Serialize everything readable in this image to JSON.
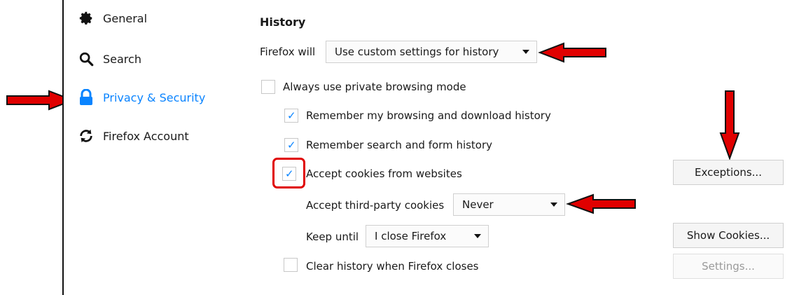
{
  "sidebar": {
    "items": [
      {
        "label": "General",
        "icon": "gear-icon"
      },
      {
        "label": "Search",
        "icon": "magnifier-icon"
      },
      {
        "label": "Privacy & Security",
        "icon": "lock-icon",
        "active": true
      },
      {
        "label": "Firefox Account",
        "icon": "sync-icon"
      }
    ]
  },
  "history": {
    "heading": "History",
    "firefox_will_label": "Firefox will",
    "firefox_will_value": "Use custom settings for history",
    "private_mode": {
      "label": "Always use private browsing mode",
      "checked": false
    },
    "remember_browsing": {
      "label": "Remember my browsing and download history",
      "checked": true
    },
    "remember_search": {
      "label": "Remember search and form history",
      "checked": true
    },
    "accept_cookies": {
      "label": "Accept cookies from websites",
      "checked": true
    },
    "third_party_label": "Accept third-party cookies",
    "third_party_value": "Never",
    "keep_until_label": "Keep until",
    "keep_until_value": "I close Firefox",
    "clear_history": {
      "label": "Clear history when Firefox closes",
      "checked": false
    },
    "exceptions_button": "Exceptions...",
    "show_cookies_button": "Show Cookies...",
    "settings_button": "Settings..."
  },
  "colors": {
    "accent": "#0a84ff",
    "annotation": "#e00000"
  }
}
